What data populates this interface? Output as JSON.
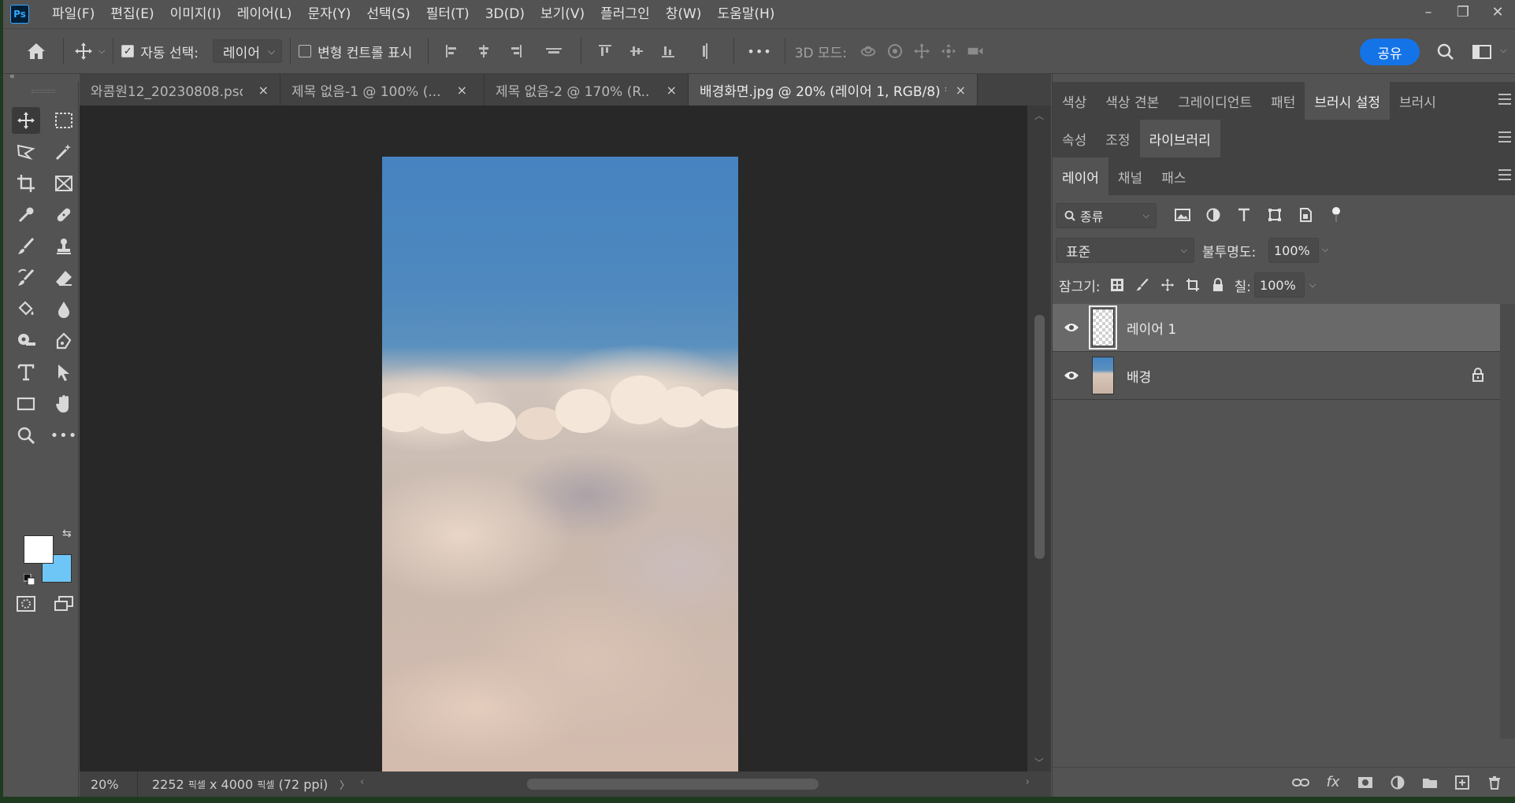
{
  "app": {
    "logo": "Ps"
  },
  "menu": [
    "파일(F)",
    "편집(E)",
    "이미지(I)",
    "레이어(L)",
    "문자(Y)",
    "선택(S)",
    "필터(T)",
    "3D(D)",
    "보기(V)",
    "플러그인",
    "창(W)",
    "도움말(H)"
  ],
  "window_controls": {
    "minimize": "–",
    "restore": "❐",
    "close": "✕"
  },
  "options": {
    "auto_select_label": "자동 선택:",
    "auto_select_checked": true,
    "auto_select_target": "레이어",
    "transform_controls_label": "변형 컨트롤 표시",
    "transform_controls_checked": false,
    "more": "•••",
    "mode_3d_label": "3D 모드:",
    "share_label": "공유"
  },
  "tabs": [
    {
      "label": "와콤원12_20230808.psd",
      "close": "×",
      "active": false
    },
    {
      "label": "제목 없음-1 @ 100% (...",
      "close": "×",
      "active": false
    },
    {
      "label": "제목 없음-2 @ 170% (R...",
      "close": "×",
      "active": false
    },
    {
      "label": "배경화면.jpg @ 20% (레이어 1, RGB/8) *",
      "close": "×",
      "active": true
    }
  ],
  "status": {
    "zoom": "20%",
    "dimensions": "2252",
    "unit1": "픽셀",
    "dims_mid": "x 4000",
    "unit2": "픽셀",
    "ppi": "(72 ppi)",
    "arrow": "〉"
  },
  "panels": {
    "row1": [
      {
        "label": "색상",
        "active": false
      },
      {
        "label": "색상 견본",
        "active": false
      },
      {
        "label": "그레이디언트",
        "active": false
      },
      {
        "label": "패턴",
        "active": false
      },
      {
        "label": "브러시 설정",
        "active": true
      },
      {
        "label": "브러시",
        "active": false
      }
    ],
    "row2": [
      {
        "label": "속성",
        "active": false
      },
      {
        "label": "조정",
        "active": false
      },
      {
        "label": "라이브러리",
        "active": true
      }
    ],
    "row3": [
      {
        "label": "레이어",
        "active": true
      },
      {
        "label": "채널",
        "active": false
      },
      {
        "label": "패스",
        "active": false
      }
    ]
  },
  "layers_panel": {
    "filter_kind": "종류",
    "blend_mode": "표준",
    "opacity_label": "불투명도:",
    "opacity_value": "100%",
    "lock_label": "잠그기:",
    "fill_label": "칠:",
    "fill_value": "100%",
    "layers": [
      {
        "name": "레이어 1",
        "selected": true,
        "locked": false,
        "thumb": "transparent"
      },
      {
        "name": "배경",
        "selected": false,
        "locked": true,
        "thumb": "image"
      }
    ],
    "footer_fx": "fx"
  },
  "colors": {
    "foreground": "#ffffff",
    "background": "#6ec6f7",
    "accent": "#1473e6"
  }
}
